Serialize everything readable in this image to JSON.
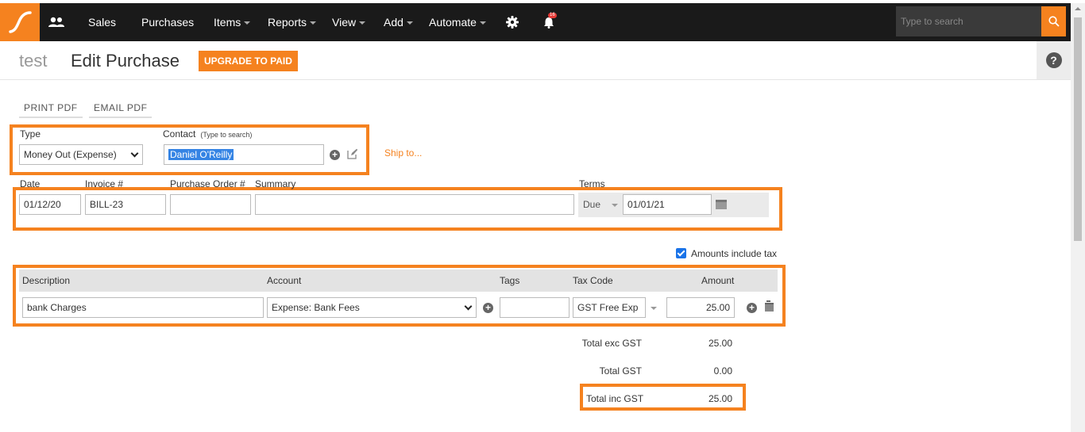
{
  "nav": {
    "items": [
      {
        "label": "Sales",
        "dropdown": false
      },
      {
        "label": "Purchases",
        "dropdown": false
      },
      {
        "label": "Items",
        "dropdown": true
      },
      {
        "label": "Reports",
        "dropdown": true
      },
      {
        "label": "View",
        "dropdown": true
      },
      {
        "label": "Add",
        "dropdown": true
      },
      {
        "label": "Automate",
        "dropdown": true
      }
    ],
    "notification_count": "16",
    "search_placeholder": "Type to search"
  },
  "header": {
    "org_name": "test",
    "title": "Edit Purchase",
    "upgrade_label": "UPGRADE TO PAID"
  },
  "actions": {
    "print_pdf": "PRINT PDF",
    "email_pdf": "EMAIL PDF"
  },
  "form": {
    "type_label": "Type",
    "type_value": "Money Out (Expense)",
    "contact_label": "Contact",
    "contact_hint": "(Type to search)",
    "contact_value": "Daniel O'Reilly",
    "ship_to": "Ship to...",
    "date_label": "Date",
    "date_value": "01/12/20",
    "invoice_label": "Invoice #",
    "invoice_value": "BILL-23",
    "po_label": "Purchase Order #",
    "po_value": "",
    "summary_label": "Summary",
    "summary_value": "",
    "terms_label": "Terms",
    "terms_type": "Due",
    "terms_date": "01/01/21"
  },
  "amounts_include_tax": {
    "checked": true,
    "label": "Amounts include tax"
  },
  "lines": {
    "headers": {
      "description": "Description",
      "account": "Account",
      "tags": "Tags",
      "tax_code": "Tax Code",
      "amount": "Amount"
    },
    "rows": [
      {
        "description": "bank Charges",
        "account": "Expense: Bank Fees",
        "tags": "",
        "tax_code": "GST Free Exp",
        "amount": "25.00"
      }
    ]
  },
  "totals": {
    "exc_label": "Total exc GST",
    "exc_value": "25.00",
    "gst_label": "Total GST",
    "gst_value": "0.00",
    "inc_label": "Total inc GST",
    "inc_value": "25.00"
  },
  "colors": {
    "brand_orange": "#f5821f",
    "topbar": "#1a1a1a",
    "checkbox_blue": "#1a73e8"
  }
}
